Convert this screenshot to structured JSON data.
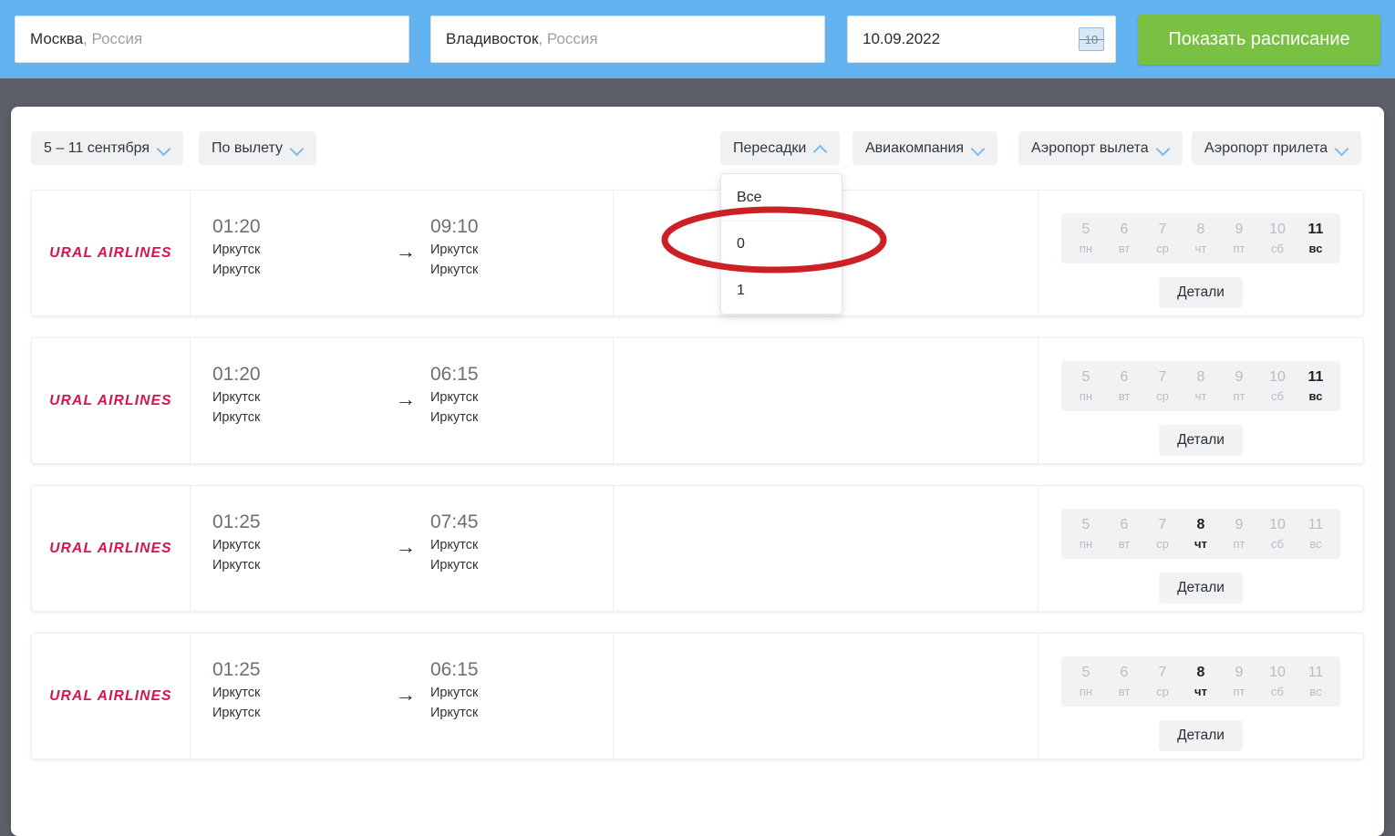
{
  "search": {
    "origin": {
      "city": "Москва",
      "country": ", Россия"
    },
    "destination": {
      "city": "Владивосток",
      "country": ", Россия"
    },
    "date": "10.09.2022",
    "calendar_icon_label": "10",
    "submit_label": "Показать расписание",
    "accent_blue": "#62b3ef",
    "submit_color": "#7ac143"
  },
  "filters": {
    "week_range": "5 – 11 сентября",
    "sort": "По вылету",
    "transfers": "Пересадки",
    "airline": "Авиакомпания",
    "departure_airport": "Аэропорт вылета",
    "arrival_airport": "Аэропорт прилета"
  },
  "transfers_dropdown": {
    "open": true,
    "options": [
      "Все",
      "0",
      "1"
    ],
    "highlighted_option": "0"
  },
  "annotation": {
    "shape": "ellipse",
    "color": "#cc2026",
    "target": "0"
  },
  "weekdays": [
    "пн",
    "вт",
    "ср",
    "чт",
    "пт",
    "сб",
    "вс"
  ],
  "day_numbers": [
    "5",
    "6",
    "7",
    "8",
    "9",
    "10",
    "11"
  ],
  "details_label": "Детали",
  "flights": [
    {
      "airline": "URAL AIRLINES",
      "depart_time": "01:20",
      "depart_city": "Иркутск",
      "depart_airport": "Иркутск",
      "arrive_time": "09:10",
      "arrive_city": "Иркутск",
      "arrive_airport": "Иркутск",
      "active_day_index": 6
    },
    {
      "airline": "URAL AIRLINES",
      "depart_time": "01:20",
      "depart_city": "Иркутск",
      "depart_airport": "Иркутск",
      "arrive_time": "06:15",
      "arrive_city": "Иркутск",
      "arrive_airport": "Иркутск",
      "active_day_index": 6
    },
    {
      "airline": "URAL AIRLINES",
      "depart_time": "01:25",
      "depart_city": "Иркутск",
      "depart_airport": "Иркутск",
      "arrive_time": "07:45",
      "arrive_city": "Иркутск",
      "arrive_airport": "Иркутск",
      "active_day_index": 3
    },
    {
      "airline": "URAL AIRLINES",
      "depart_time": "01:25",
      "depart_city": "Иркутск",
      "depart_airport": "Иркутск",
      "arrive_time": "06:15",
      "arrive_city": "Иркутск",
      "arrive_airport": "Иркутск",
      "active_day_index": 3
    }
  ],
  "arrow_glyph": "→"
}
